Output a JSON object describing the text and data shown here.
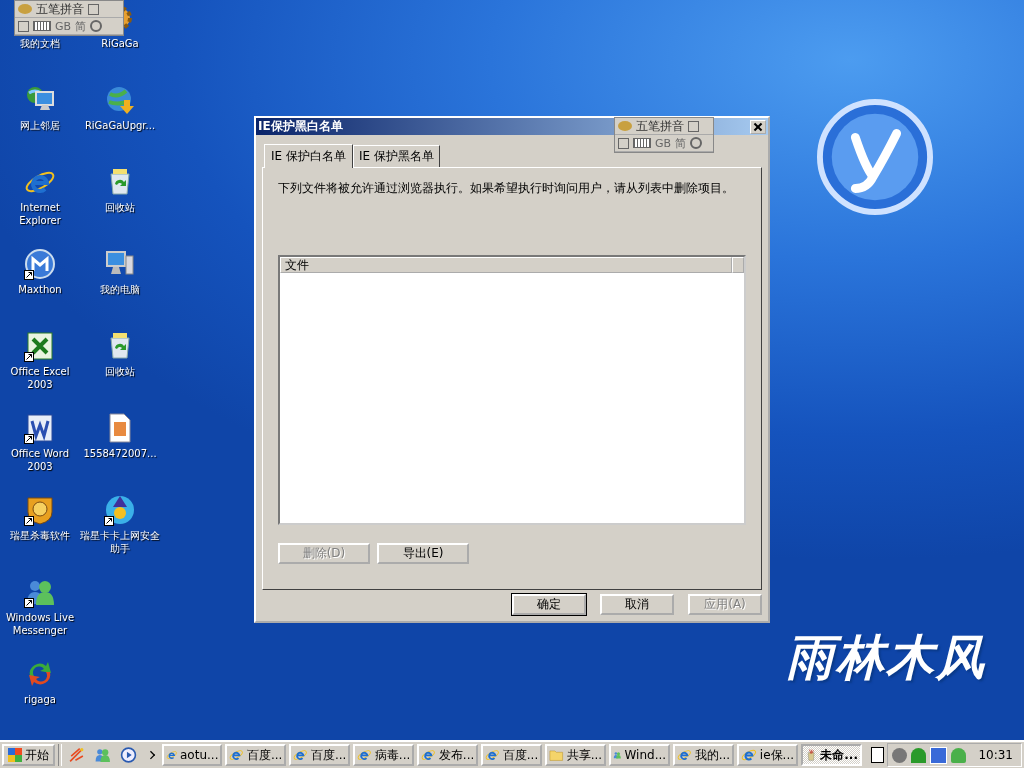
{
  "desktop": {
    "icon_columns": [
      [
        {
          "label": "我的文档",
          "kind": "docs"
        },
        {
          "label": "网上邻居",
          "kind": "network",
          "shortcut": false
        },
        {
          "label": "Internet Explorer",
          "kind": "ie",
          "shortcut": false
        },
        {
          "label": "Maxthon",
          "kind": "maxthon",
          "shortcut": true
        },
        {
          "label": "Office Excel 2003",
          "kind": "excel",
          "shortcut": true
        },
        {
          "label": "Office Word 2003",
          "kind": "word",
          "shortcut": true
        },
        {
          "label": "瑞星杀毒软件",
          "kind": "lion",
          "shortcut": true
        },
        {
          "label": "Windows Live Messenger",
          "kind": "people",
          "shortcut": true
        },
        {
          "label": "rigaga",
          "kind": "arrows",
          "shortcut": false
        }
      ],
      [
        {
          "label": "RiGaGa",
          "kind": "gear"
        },
        {
          "label": "RiGaGaUpgr...",
          "kind": "globe",
          "shortcut": false
        },
        {
          "label": "回收站",
          "kind": "recycle",
          "shortcut": false
        },
        {
          "label": "我的电脑",
          "kind": "computer",
          "shortcut": false
        },
        {
          "label": "回收站",
          "kind": "recycle",
          "shortcut": false
        },
        {
          "label": "1558472007...",
          "kind": "file",
          "shortcut": false
        },
        {
          "label": "瑞星卡卡上网安全助手",
          "kind": "wizard",
          "shortcut": true
        }
      ]
    ],
    "wallpaper_logo": "雨林木风"
  },
  "ime_bars": [
    {
      "label": "五笔拼音",
      "codes": [
        "GB",
        "简"
      ]
    },
    {
      "label": "五笔拼音",
      "codes": [
        "GB",
        "简"
      ]
    }
  ],
  "dialog": {
    "title": "IE保护黑白名单",
    "tabs": [
      {
        "label": "IE 保护白名单",
        "selected": true
      },
      {
        "label": "IE 保护黑名单",
        "selected": false
      }
    ],
    "description": "下列文件将被允许通过浏览器执行。如果希望执行时询问用户，请从列表中删除项目。",
    "list": {
      "columns": [
        "文件"
      ]
    },
    "list_buttons": [
      {
        "label": "删除(D)",
        "disabled": true
      },
      {
        "label": "导出(E)",
        "disabled": false
      }
    ],
    "footer_buttons": [
      {
        "label": "确定",
        "disabled": false,
        "default": true
      },
      {
        "label": "取消",
        "disabled": false,
        "default": false
      },
      {
        "label": "应用(A)",
        "disabled": true,
        "default": false
      }
    ]
  },
  "taskbar": {
    "start": "开始",
    "tasks": [
      {
        "label": "aotu...",
        "kind": "ie",
        "selected": false
      },
      {
        "label": "百度...",
        "kind": "ie",
        "selected": false
      },
      {
        "label": "百度...",
        "kind": "ie",
        "selected": false
      },
      {
        "label": "病毒...",
        "kind": "ie",
        "selected": false
      },
      {
        "label": "发布...",
        "kind": "ie",
        "selected": false
      },
      {
        "label": "百度...",
        "kind": "ie",
        "selected": false
      },
      {
        "label": "共享...",
        "kind": "folder",
        "selected": false
      },
      {
        "label": "Wind...",
        "kind": "people",
        "selected": false
      },
      {
        "label": "我的...",
        "kind": "ie",
        "selected": false
      },
      {
        "label": "ie保...",
        "kind": "ie",
        "selected": false
      },
      {
        "label": "未命...",
        "kind": "paint",
        "selected": true
      }
    ],
    "clock": "10:31"
  }
}
